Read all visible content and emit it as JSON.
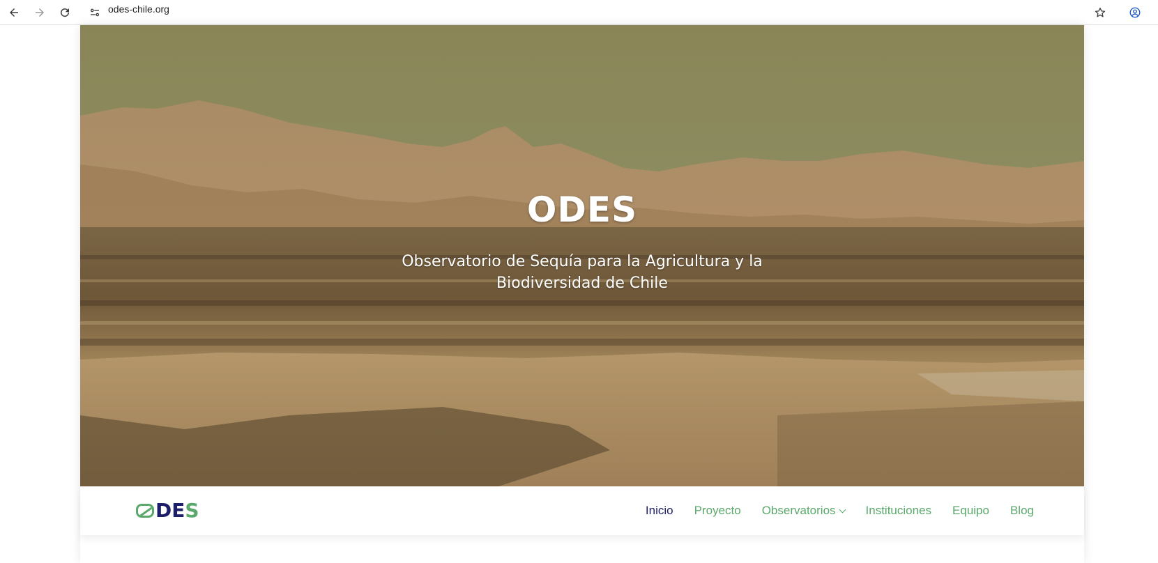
{
  "browser": {
    "url": "odes-chile.org",
    "icons": [
      "back-arrow-icon",
      "forward-arrow-icon",
      "reload-icon",
      "site-settings-icon",
      "bookmark-star-icon",
      "profile-icon"
    ]
  },
  "hero": {
    "title": "ODES",
    "subtitle_line1": "Observatorio de Sequía para la Agricultura y la",
    "subtitle_line2": "Biodiversidad de Chile"
  },
  "logo": {
    "o": "O",
    "d": "D",
    "e": "E",
    "s": "S"
  },
  "nav": {
    "inicio": "Inicio",
    "proyecto": "Proyecto",
    "observatorios": "Observatorios",
    "instituciones": "Instituciones",
    "equipo": "Equipo",
    "blog": "Blog"
  },
  "colors": {
    "nav_green": "#5aa86b",
    "nav_active": "#1e1f6b",
    "hero_tint": "#8f7348"
  }
}
